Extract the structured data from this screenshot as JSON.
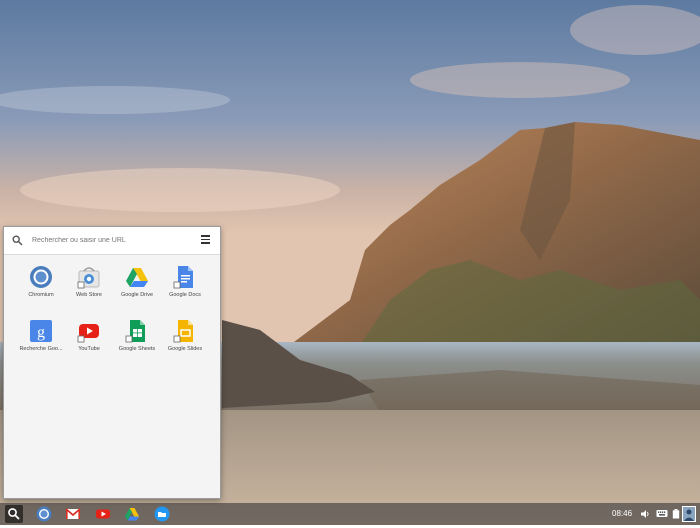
{
  "launcher": {
    "search_placeholder": "Rechercher ou saisir une URL",
    "apps": [
      {
        "label": "Chromium",
        "icon": "chromium-icon"
      },
      {
        "label": "Web Store",
        "icon": "web-store-icon"
      },
      {
        "label": "Google Drive",
        "icon": "google-drive-icon"
      },
      {
        "label": "Google Docs",
        "icon": "google-docs-icon"
      },
      {
        "label": "Recherche Goo...",
        "icon": "google-search-icon"
      },
      {
        "label": "YouTube",
        "icon": "youtube-icon"
      },
      {
        "label": "Google Sheets",
        "icon": "google-sheets-icon"
      },
      {
        "label": "Google Slides",
        "icon": "google-slides-icon"
      }
    ]
  },
  "shelf": {
    "pinned": [
      "chromium-icon",
      "gmail-icon",
      "youtube-icon",
      "google-drive-icon",
      "files-icon"
    ],
    "clock": "08:46"
  }
}
